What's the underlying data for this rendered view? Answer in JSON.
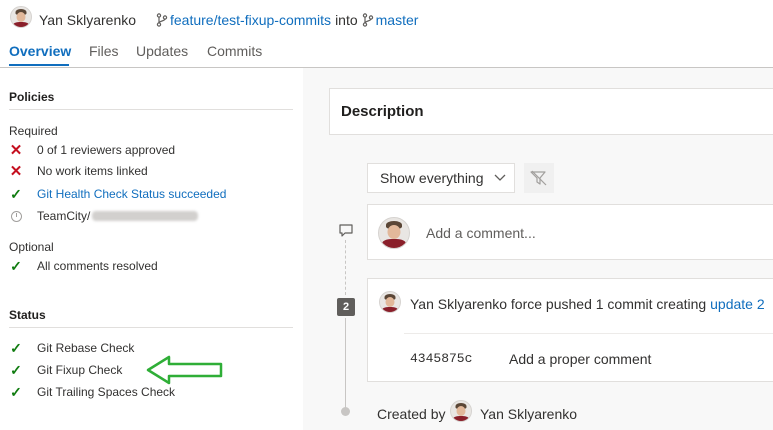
{
  "header": {
    "author_name": "Yan Sklyarenko",
    "source_branch": "feature/test-fixup-commits",
    "into_text": "into",
    "target_branch": "master"
  },
  "tabs": [
    {
      "label": "Overview",
      "active": true
    },
    {
      "label": "Files"
    },
    {
      "label": "Updates"
    },
    {
      "label": "Commits"
    }
  ],
  "policies": {
    "title": "Policies",
    "required_label": "Required",
    "required": [
      {
        "status": "fail",
        "text": "0 of 1 reviewers approved"
      },
      {
        "status": "fail",
        "text": "No work items linked"
      },
      {
        "status": "pass",
        "text": "Git Health Check Status succeeded",
        "link": true
      },
      {
        "status": "pending",
        "text": "TeamCity/"
      }
    ],
    "optional_label": "Optional",
    "optional": [
      {
        "status": "pass",
        "text": "All comments resolved"
      }
    ]
  },
  "status": {
    "title": "Status",
    "items": [
      {
        "status": "pass",
        "text": "Git Rebase Check"
      },
      {
        "status": "pass",
        "text": "Git Fixup Check"
      },
      {
        "status": "pass",
        "text": "Git Trailing Spaces Check"
      }
    ]
  },
  "description": {
    "title": "Description"
  },
  "filter": {
    "dropdown_value": "Show everything"
  },
  "comment": {
    "placeholder": "Add a comment..."
  },
  "timeline": {
    "badge": "2",
    "push_event": {
      "author": "Yan Sklyarenko",
      "text": " force pushed 1 commit creating ",
      "link": "update 2"
    },
    "commit": {
      "hash": "4345875c",
      "message": "Add a proper comment"
    },
    "created_by_label": "Created by",
    "created_by_name": "Yan Sklyarenko"
  },
  "colors": {
    "link": "#106ebe",
    "fail": "#c50f1f",
    "pass": "#107c10",
    "annotation_arrow": "#2fae37"
  }
}
